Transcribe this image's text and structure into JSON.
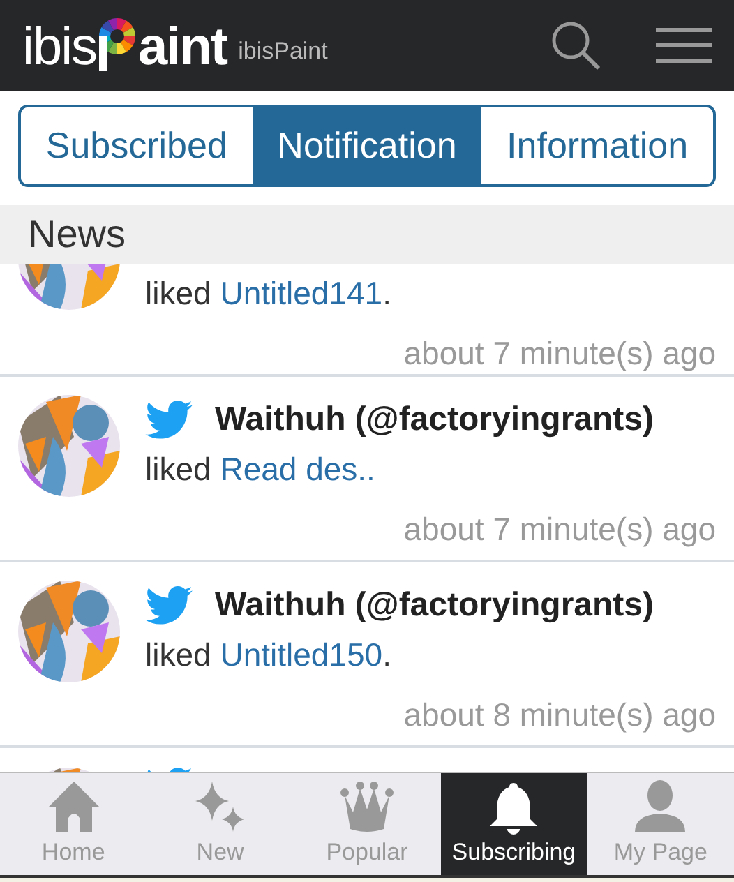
{
  "header": {
    "logo_text_left": "ibis",
    "logo_text_right": "aint",
    "site_name": "ibisPaint"
  },
  "tabs": [
    {
      "label": "Subscribed",
      "selected": false
    },
    {
      "label": "Notification",
      "selected": true
    },
    {
      "label": "Information",
      "selected": false
    }
  ],
  "section_title": "News",
  "notifications": [
    {
      "kind": "cut_top",
      "action": "liked",
      "link": "Untitled141",
      "suffix": ".",
      "time": "about 7 minute(s) ago"
    },
    {
      "kind": "full",
      "user": "Waithuh (@factoryingrants)",
      "action": "liked",
      "link": "Read des..",
      "time": "about 7 minute(s) ago"
    },
    {
      "kind": "full",
      "user": "Waithuh (@factoryingrants)",
      "action": "liked",
      "link": "Untitled150",
      "suffix": ".",
      "time": "about 8 minute(s) ago"
    },
    {
      "kind": "cut_bottom"
    }
  ],
  "bottom_nav": [
    {
      "label": "Home",
      "kind": "home",
      "selected": false
    },
    {
      "label": "New",
      "kind": "sparkle",
      "selected": false
    },
    {
      "label": "Popular",
      "kind": "crown",
      "selected": false
    },
    {
      "label": "Subscribing",
      "kind": "bell",
      "selected": true
    },
    {
      "label": "My Page",
      "kind": "person",
      "selected": false
    }
  ]
}
